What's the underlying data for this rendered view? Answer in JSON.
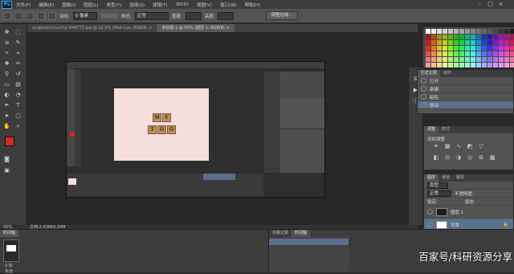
{
  "app": {
    "logo": "Ps"
  },
  "menu": [
    "文件(F)",
    "编辑(E)",
    "图像(I)",
    "图层(L)",
    "类型(Y)",
    "选择(S)",
    "滤镜(T)",
    "3D(D)",
    "视图(V)",
    "窗口(W)",
    "帮助(H)"
  ],
  "options_bar": {
    "feather_label": "羽化:",
    "feather_value": "0 像素",
    "antialias_label": "消除锯齿",
    "style_label": "样式:",
    "style_value": "正常",
    "width_label": "宽度:",
    "height_label": "高度:",
    "refine_edge_button": "调整边缘..."
  },
  "document_tabs": [
    {
      "label": "unsplash-crunchy 944773.jpg @ 12.5% (Mist-Lua, RGB/8) ×",
      "active": false
    },
    {
      "label": "未标题-1 @ 50% (图层 1, RGB/8) ×",
      "active": true
    }
  ],
  "canvas_image": {
    "tile_text_row1": [
      "M",
      "E"
    ],
    "tile_text_row2": [
      "T",
      "O",
      "O"
    ]
  },
  "status": {
    "zoom": "50%",
    "doc_size": "文档:2.63M/4.20M"
  },
  "history_panel": {
    "tabs": [
      "历史记录",
      "动作"
    ],
    "items": [
      "打开",
      "新建",
      "粘贴",
      "移动"
    ]
  },
  "adjustments_panel": {
    "tabs": [
      "调整",
      "样式"
    ],
    "title": "添加调整"
  },
  "layers_panel": {
    "tabs": [
      "图层",
      "通道",
      "路径"
    ],
    "kind_label": "类型",
    "blend_mode": "正常",
    "opacity_label": "不透明度:",
    "lock_label": "锁定:",
    "fill_label": "填充:",
    "layers": [
      {
        "name": "图层 1",
        "selected": false
      },
      {
        "name": "背景",
        "selected": true
      }
    ]
  },
  "timeline": {
    "tabs": [
      "时间轴"
    ],
    "frame_time": "0 秒",
    "loop_label": "永远"
  },
  "bottom_panel": {
    "tabs": [
      "测量记录",
      "时间轴"
    ]
  },
  "watermark": "百家号/科研资源分享",
  "colors": {
    "foreground": "#d62828",
    "background": "#ffffff",
    "selection": "#5b6f8e"
  }
}
